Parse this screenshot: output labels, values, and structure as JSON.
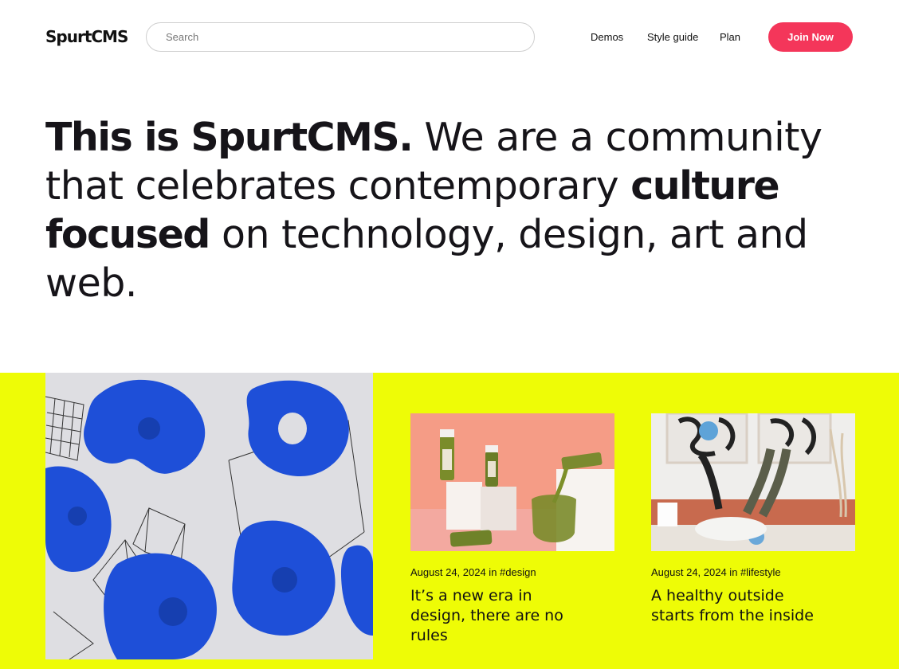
{
  "header": {
    "logo": "SpurtCMS",
    "search_placeholder": "Search",
    "nav": {
      "demos": "Demos",
      "style_guide": "Style guide",
      "plan": "Plan"
    },
    "join_label": "Join Now"
  },
  "hero": {
    "part1_bold": "This is SpurtCMS.",
    "part2": " We are a community that celebrates contemporary ",
    "part3_bold": "culture focused",
    "part4": " on technology, design, art and web."
  },
  "colors": {
    "accent": "#f4365a",
    "band": "#eefc06",
    "text": "#161419"
  },
  "posts": [
    {
      "meta": "August 24, 2024 in #design",
      "title": "It’s a new era in design, there are no rules",
      "image": "juice-bottles-image"
    },
    {
      "meta": "August 24, 2024 in #lifestyle",
      "title": "A healthy outside starts from the inside",
      "image": "couple-on-bed-image"
    }
  ],
  "feature_image": "blue-3d-shapes-image"
}
